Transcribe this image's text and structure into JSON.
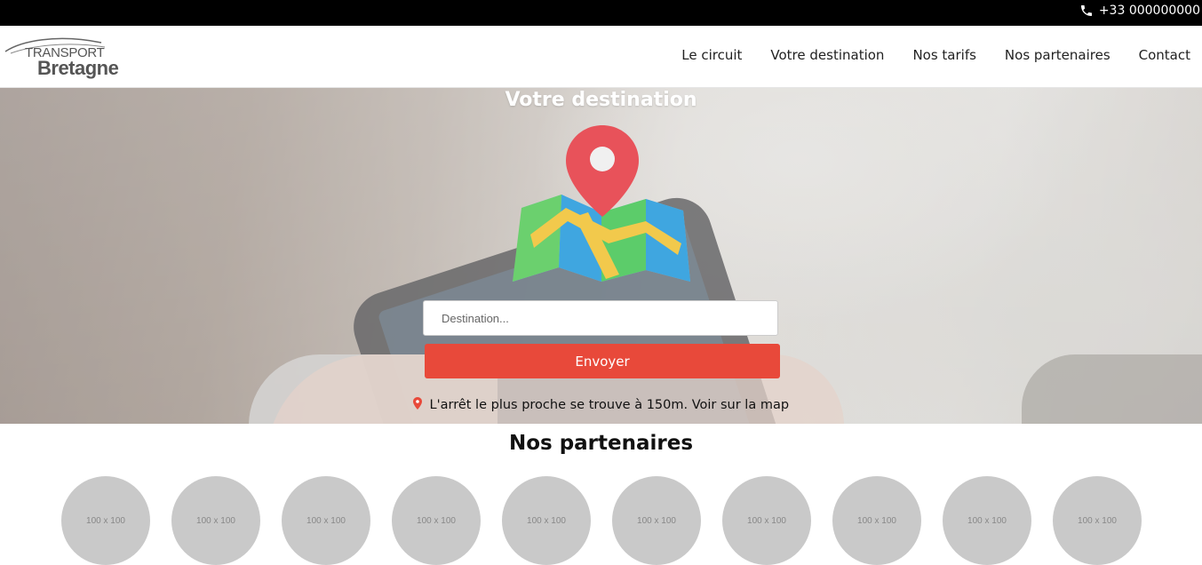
{
  "topbar": {
    "phone": "+33 000000000",
    "phone_icon": "phone-icon"
  },
  "logo": {
    "line1": "TRANSPORT",
    "line2": "Bretagne"
  },
  "nav": {
    "items": [
      {
        "label": "Le circuit"
      },
      {
        "label": "Votre destination"
      },
      {
        "label": "Nos tarifs"
      },
      {
        "label": "Nos partenaires"
      },
      {
        "label": "Contact"
      }
    ]
  },
  "hero": {
    "title": "Votre destination",
    "map_icon": "map-pin-icon",
    "input_placeholder": "Destination...",
    "button_label": "Envoyer",
    "nearest_text": "L'arrêt le plus proche se trouve à 150m. Voir sur la map",
    "accent": "#e8493a"
  },
  "partners": {
    "title": "Nos partenaires",
    "items": [
      "100 x 100",
      "100 x 100",
      "100 x 100",
      "100 x 100",
      "100 x 100",
      "100 x 100",
      "100 x 100",
      "100 x 100",
      "100 x 100",
      "100 x 100"
    ]
  }
}
